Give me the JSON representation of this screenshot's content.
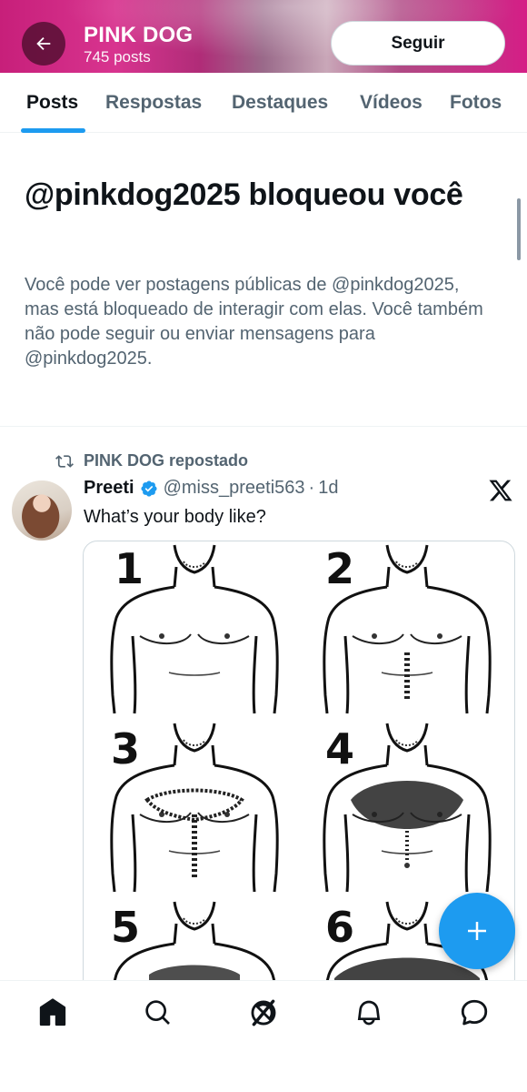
{
  "header": {
    "title": "PINK DOG",
    "subtitle": "745 posts",
    "follow_label": "Seguir",
    "back_icon": "arrow-left-icon",
    "gradient_colors": [
      "#c71f7a",
      "#d51e86"
    ]
  },
  "tabs": [
    {
      "label": "Posts",
      "active": true
    },
    {
      "label": "Respostas",
      "active": false
    },
    {
      "label": "Destaques",
      "active": false
    },
    {
      "label": "Vídeos",
      "active": false
    },
    {
      "label": "Fotos",
      "active": false
    }
  ],
  "blocked": {
    "title": "@pinkdog2025 bloqueou você",
    "description": "Você pode ver postagens públicas de @pinkdog2025, mas está bloqueado de interagir com elas. Você também não pode seguir ou enviar mensagens para @pinkdog2025."
  },
  "post": {
    "repost_label": "PINK DOG repostado",
    "author_name": "Preeti",
    "author_handle": "@miss_preeti563",
    "separator": "·",
    "time": "1d",
    "text": "What’s your body like?",
    "media_labels": [
      "1",
      "2",
      "3",
      "4",
      "5",
      "6"
    ],
    "verified_icon": "verified-badge-icon",
    "source_icon": "x-logo-icon"
  },
  "fab": {
    "icon": "plus-icon"
  },
  "bottom_nav": [
    {
      "icon": "home-icon",
      "active": true
    },
    {
      "icon": "search-icon",
      "active": false
    },
    {
      "icon": "grok-icon",
      "active": false
    },
    {
      "icon": "bell-icon",
      "active": false
    },
    {
      "icon": "message-icon",
      "active": false
    }
  ],
  "colors": {
    "accent": "#1d9bf0",
    "text": "#0f1419",
    "muted": "#536471"
  }
}
